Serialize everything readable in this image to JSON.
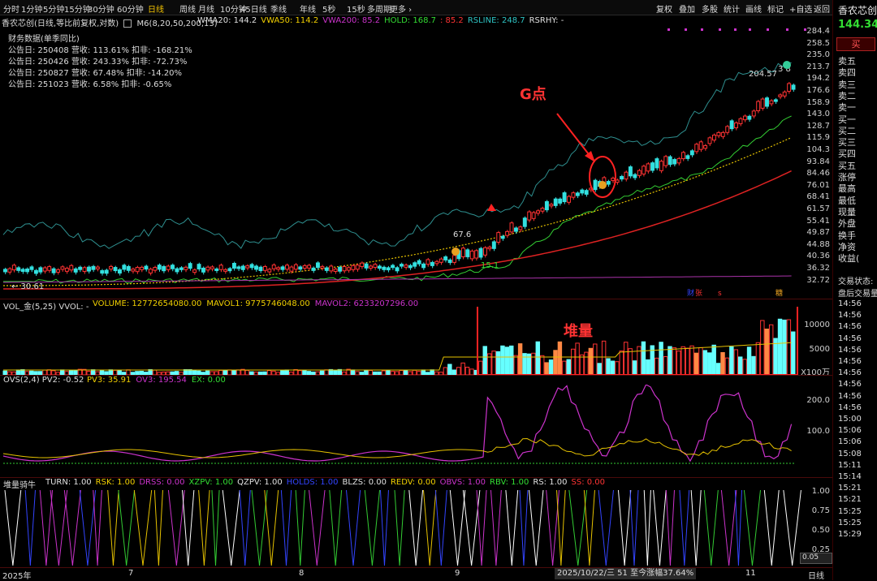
{
  "toolbar": {
    "tabs": [
      "分时",
      "1分钟",
      "5分钟",
      "15分钟",
      "30分钟",
      "60分钟",
      "日线",
      "周线",
      "月线",
      "10分钟",
      "45日线",
      "季线",
      "年线",
      "5秒",
      "15秒",
      "多周期",
      "更多"
    ],
    "active_tab": "日线",
    "right_buttons": [
      "复权",
      "叠加",
      "多股",
      "统计",
      "画线",
      "标记",
      "+自选",
      "返回"
    ]
  },
  "stock": {
    "name": "香农芯创",
    "price": "144.34",
    "buy_button": "买"
  },
  "order_book": {
    "labels": [
      "卖五",
      "卖四",
      "卖三",
      "卖二",
      "卖一",
      "买一",
      "买二",
      "买三",
      "买四",
      "买五",
      "涨停",
      "最高",
      "最低",
      "现量",
      "外盘",
      "换手",
      "净资",
      "收益(",
      ""
    ],
    "status": "交易状态:",
    "status_value": "盘后交易量"
  },
  "main_chart": {
    "header": "香农芯创(日线,等比前复权,对数)",
    "ma_name": "M6(8,20,50,200,13)",
    "indicators": [
      {
        "text": "WMA20: 144.2",
        "color": "#e0e0e0"
      },
      {
        "text": "VWA50: 114.2",
        "color": "#f2d000"
      },
      {
        "text": "VWA200: 85.2",
        "color": "#cc33cc"
      },
      {
        "text": "HOLD: 168.7",
        "color": "#33dd33"
      },
      {
        "text": ": 85.2",
        "color": "#ff3333"
      },
      {
        "text": "RSLINE: 248.7",
        "color": "#2ec4c4"
      },
      {
        "text": "RSRHY: -",
        "color": "#e0e0e0"
      }
    ],
    "fin_title": "财务数据(单季同比)",
    "fin_rows": [
      "公告日: 250408   营收: 113.61%   扣非: -168.21%",
      "公告日: 250426   营收: 243.33%   扣非: -72.73%",
      "公告日: 250827   营收: 67.48%   扣非: -14.20%",
      "公告日: 251023   营收: 6.58%   扣非: -0.65%"
    ],
    "y_axis": [
      "284.4",
      "258.5",
      "235.0",
      "213.7",
      "194.2",
      "176.6",
      "158.9",
      "143.0",
      "128.7",
      "115.9",
      "104.3",
      "93.84",
      "84.46",
      "76.01",
      "68.41",
      "61.57",
      "55.41",
      "49.87",
      "44.88",
      "40.36",
      "36.32",
      "32.72"
    ],
    "annotation_g": "G点",
    "label_high": "204.57",
    "label_start": "30.61",
    "label_67": "67.6",
    "label_15": "15.1",
    "label_tail": "3 8",
    "markers": [
      "财",
      "张",
      "s",
      "糖"
    ]
  },
  "vol_panel": {
    "title": "VOL_金(5,25) VVOL: -",
    "indicators": [
      {
        "text": "VOLUME: 12772654080.00",
        "color": "#f2d000"
      },
      {
        "text": "MAVOL1: 9775746048.00",
        "color": "#f2d000"
      },
      {
        "text": "MAVOL2: 6233207296.00",
        "color": "#cc33cc"
      }
    ],
    "annotation": "堆量",
    "y_axis": [
      "10000",
      "5000"
    ],
    "unit": "X100万"
  },
  "ovs_panel": {
    "title": "OVS(2,4) PV2: -0.52",
    "indicators": [
      {
        "text": "PV3: 35.91",
        "color": "#f2d000"
      },
      {
        "text": "OV3: 195.54",
        "color": "#cc33cc"
      },
      {
        "text": "EX: 0.00",
        "color": "#33dd33"
      }
    ],
    "y_axis": [
      "200.0",
      "100.0"
    ]
  },
  "bull_panel": {
    "title": "堆量骑牛",
    "indicators": [
      {
        "text": "TURN: 1.00",
        "color": "#e0e0e0"
      },
      {
        "text": "RSK: 1.00",
        "color": "#f2d000"
      },
      {
        "text": "DRSS: 0.00",
        "color": "#cc33cc"
      },
      {
        "text": "XZPV: 1.00",
        "color": "#33dd33"
      },
      {
        "text": "QZPV: 1.00",
        "color": "#e0e0e0"
      },
      {
        "text": "HOLDS: 1.00",
        "color": "#3344ff"
      },
      {
        "text": "BLZS: 0.00",
        "color": "#e0e0e0"
      },
      {
        "text": "REDV: 0.00",
        "color": "#f2d000"
      },
      {
        "text": "OBVS: 1.00",
        "color": "#cc33cc"
      },
      {
        "text": "RBV: 1.00",
        "color": "#33dd33"
      },
      {
        "text": "RS: 1.00",
        "color": "#e0e0e0"
      },
      {
        "text": "SS: 0.00",
        "color": "#ff3333"
      }
    ],
    "y_axis": [
      "1.00",
      "0.75",
      "0.50",
      "0.25"
    ],
    "value_box": "0.05"
  },
  "time_axis": {
    "labels": [
      "2025年",
      "7",
      "8",
      "9",
      "11"
    ],
    "status": "2025/10/22/三 51 至今涨幅37.64%",
    "right_label": "日线"
  },
  "time_column": [
    "14:56",
    "14:56",
    "14:56",
    "14:56",
    "14:56",
    "14:56",
    "14:56",
    "14:56",
    "14:56",
    "14:56",
    "15:00",
    "15:06",
    "15:06",
    "15:08",
    "15:11",
    "15:14",
    "15:21",
    "15:21",
    "15:25",
    "15:25",
    "15:29"
  ]
}
